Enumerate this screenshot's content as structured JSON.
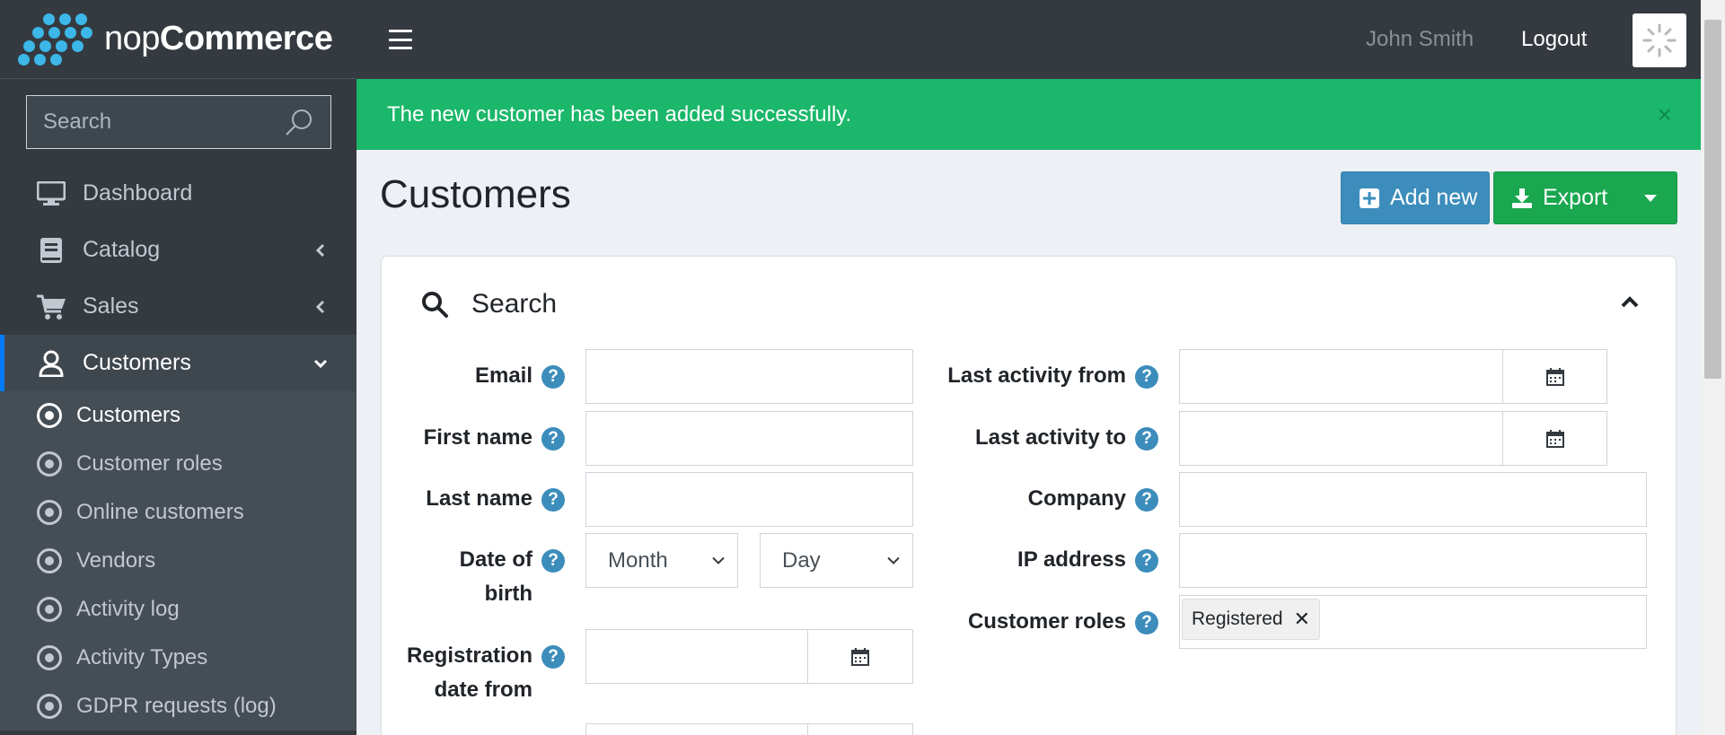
{
  "brand": {
    "name_light": "nop",
    "name_bold": "Commerce"
  },
  "sidebar": {
    "search_placeholder": "Search",
    "nav": [
      {
        "label": "Dashboard",
        "icon": "monitor-icon"
      },
      {
        "label": "Catalog",
        "icon": "book-icon"
      },
      {
        "label": "Sales",
        "icon": "cart-icon"
      },
      {
        "label": "Customers",
        "icon": "user-icon"
      }
    ],
    "sub": [
      {
        "label": "Customers"
      },
      {
        "label": "Customer roles"
      },
      {
        "label": "Online customers"
      },
      {
        "label": "Vendors"
      },
      {
        "label": "Activity log"
      },
      {
        "label": "Activity Types"
      },
      {
        "label": "GDPR requests (log)"
      }
    ]
  },
  "header": {
    "user": "John Smith",
    "logout": "Logout"
  },
  "alert": {
    "message": "The new customer has been added successfully.",
    "close": "×"
  },
  "page": {
    "title": "Customers",
    "add_new": "Add new",
    "export": "Export"
  },
  "search": {
    "title": "Search",
    "email_label": "Email",
    "first_name_label": "First name",
    "last_name_label": "Last name",
    "dob_label_1": "Date of",
    "dob_label_2": "birth",
    "dob_month": "Month",
    "dob_day": "Day",
    "reg_from_label_1": "Registration",
    "reg_from_label_2": "date from",
    "last_activity_from_label": "Last activity from",
    "last_activity_to_label": "Last activity to",
    "company_label": "Company",
    "ip_label": "IP address",
    "roles_label": "Customer roles",
    "roles_selected": "Registered",
    "help": "?"
  },
  "colors": {
    "sidebar_bg": "#343a40",
    "alert_green": "#1bb76a",
    "add_blue": "#3c8dbc",
    "export_green": "#1aa74f",
    "active_border": "#007bff"
  }
}
